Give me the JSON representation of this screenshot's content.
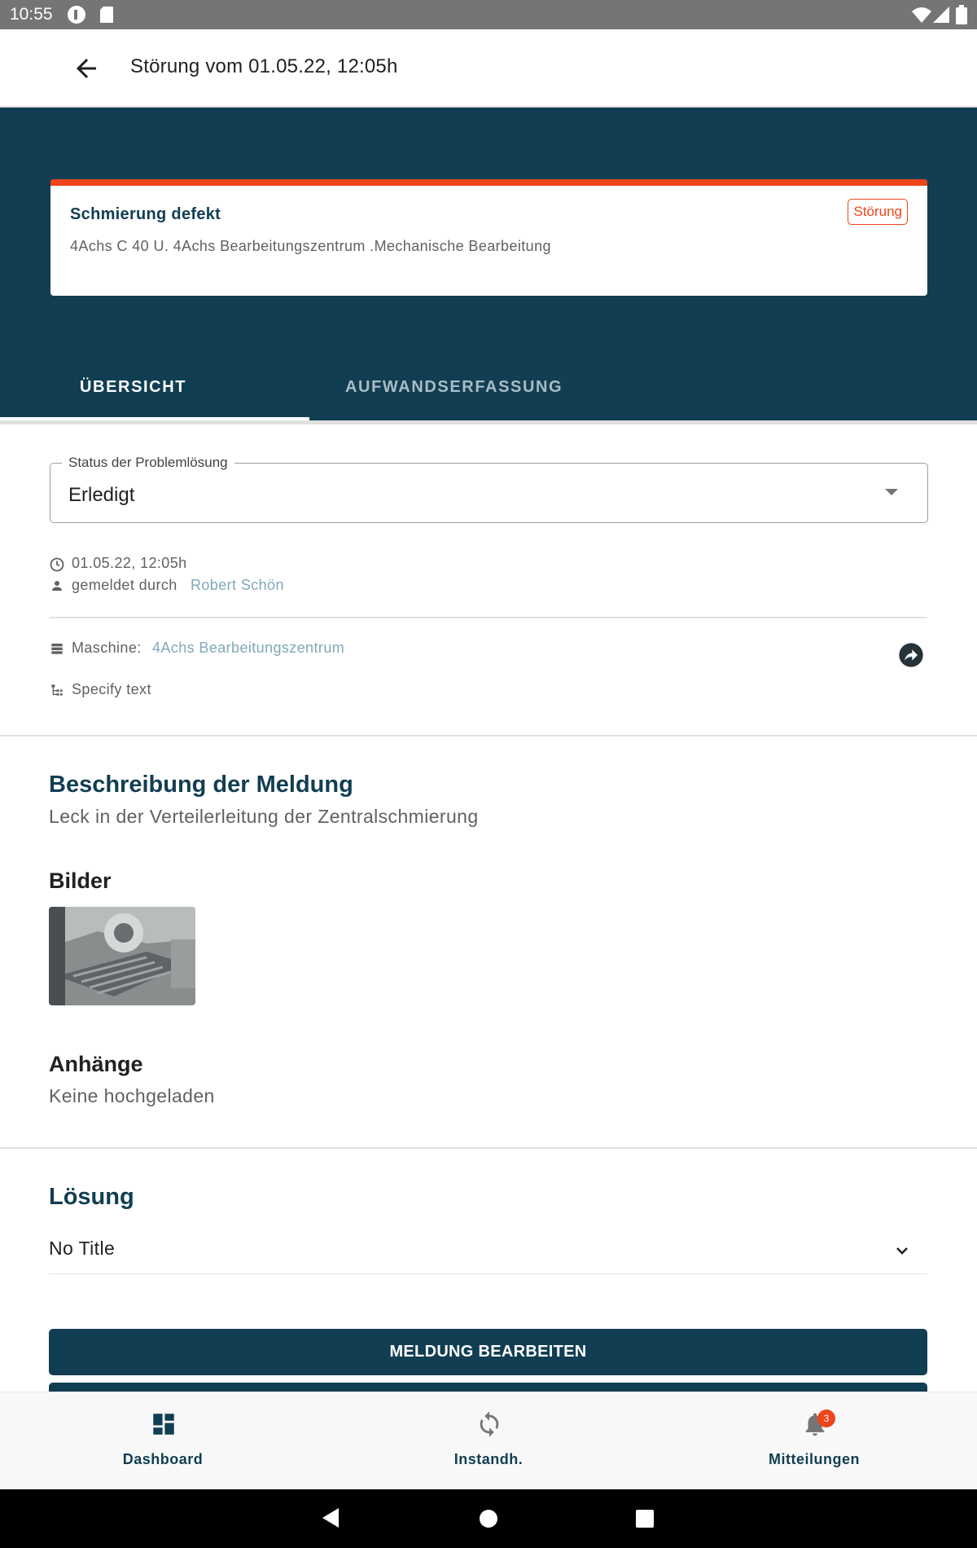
{
  "status_bar": {
    "time": "10:55"
  },
  "app_bar": {
    "title": "Störung vom 01.05.22, 12:05h",
    "back_icon": "arrow-back-icon"
  },
  "card": {
    "title": "Schmierung defekt",
    "subtitle": "4Achs C 40 U. 4Achs Bearbeitungszentrum .Mechanische Bearbeitung",
    "badge": "Störung",
    "accent_color": "#f0441b"
  },
  "tabs": [
    {
      "label": "ÜBERSICHT",
      "active": true
    },
    {
      "label": "AUFWANDSERFASSUNG",
      "active": false
    }
  ],
  "status_field": {
    "label": "Status der Problemlösung",
    "value": "Erledigt"
  },
  "meta": {
    "datetime": "01.05.22, 12:05h",
    "reported_by_prefix": "gemeldet durch",
    "reported_by": "Robert Schön",
    "machine_label": "Maschine:",
    "machine": "4Achs Bearbeitungszentrum",
    "specify": "Specify text"
  },
  "description": {
    "heading": "Beschreibung der Meldung",
    "text": "Leck in der Verteilerleitung der Zentralschmierung"
  },
  "images": {
    "heading": "Bilder"
  },
  "attachments": {
    "heading": "Anhänge",
    "text": "Keine hochgeladen"
  },
  "solution": {
    "heading": "Lösung",
    "item": "No Title"
  },
  "actions": {
    "edit": "MELDUNG BEARBEITEN"
  },
  "bottom_nav": [
    {
      "label": "Dashboard",
      "icon": "dashboard-icon"
    },
    {
      "label": "Instandh.",
      "icon": "sync-icon"
    },
    {
      "label": "Mitteilungen",
      "icon": "bell-icon",
      "badge": "3"
    }
  ],
  "colors": {
    "primary": "#113e52",
    "accent": "#f0441b",
    "link": "#7fa9b9"
  }
}
